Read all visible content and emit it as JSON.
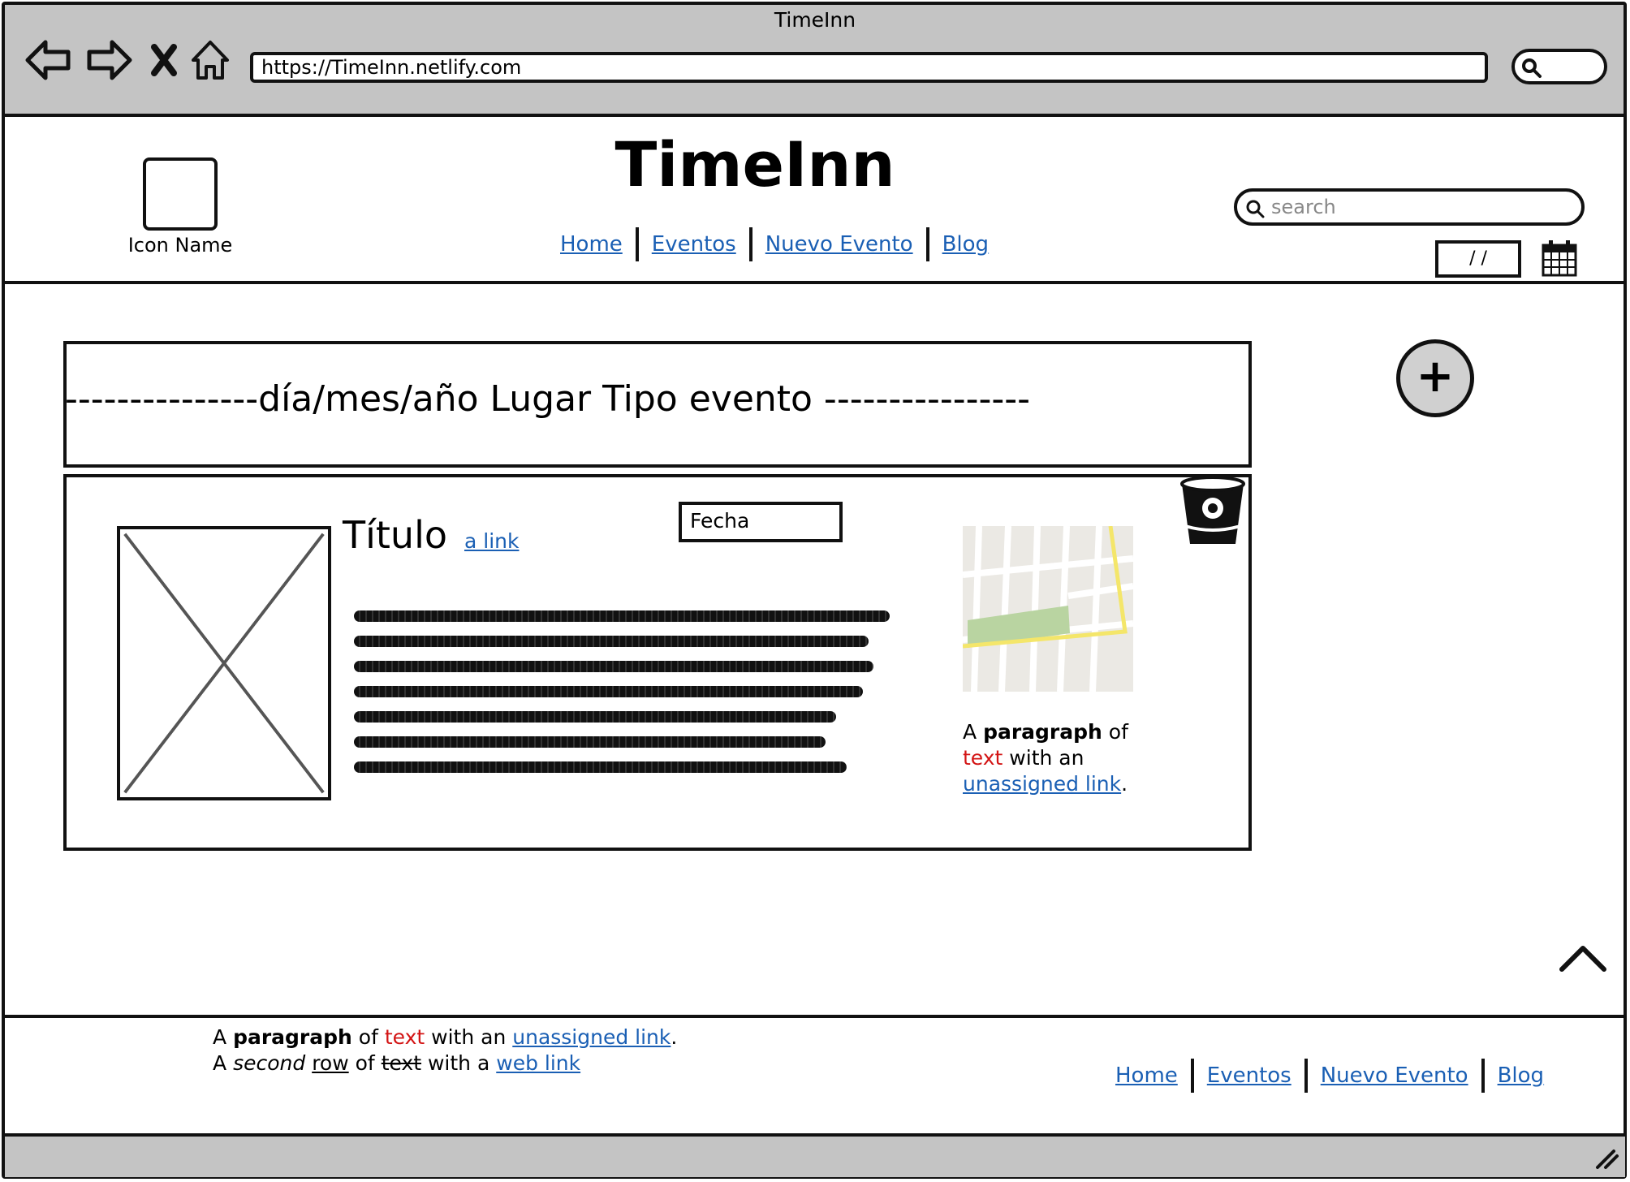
{
  "browser": {
    "title": "TimeInn",
    "url": "https://TimeInn.netlify.com"
  },
  "header": {
    "logo_label": "Icon Name",
    "site_title": "TimeInn",
    "nav": [
      "Home",
      "Eventos",
      "Nuevo Evento",
      "Blog"
    ],
    "search_placeholder": "search",
    "date_value": "/ /"
  },
  "filter": {
    "text": "---------------día/mes/año  Lugar Tipo evento ----------------"
  },
  "add_button_symbol": "+",
  "card": {
    "title": "Título",
    "link": "a link",
    "date_field": "Fecha",
    "side_paragraph": {
      "a": "A",
      "bold": "paragraph",
      "of": "of",
      "red": "text",
      "with": "with an",
      "link": "unassigned link",
      "end": "."
    }
  },
  "footer": {
    "row1": {
      "a": "A",
      "bold": "paragraph",
      "of": "of",
      "red": "text",
      "with": "with an",
      "link": "unassigned link",
      "end": "."
    },
    "row2": {
      "a": "A",
      "italic": "second",
      "underlined": "row",
      "of": "of",
      "strike": "text",
      "with": "with a",
      "link": "web link"
    },
    "nav": [
      "Home",
      "Eventos",
      "Nuevo Evento",
      "Blog"
    ]
  },
  "icons": [
    "back-arrow-icon",
    "forward-arrow-icon",
    "close-x-icon",
    "home-icon",
    "search-icon",
    "calendar-icon",
    "plus-icon",
    "trash-icon",
    "image-placeholder-icon",
    "map-icon",
    "chevron-up-icon",
    "resize-grip-icon"
  ],
  "colors": {
    "link": "#1a5fb4",
    "red_text": "#d31414",
    "chrome": "#c4c4c4"
  }
}
